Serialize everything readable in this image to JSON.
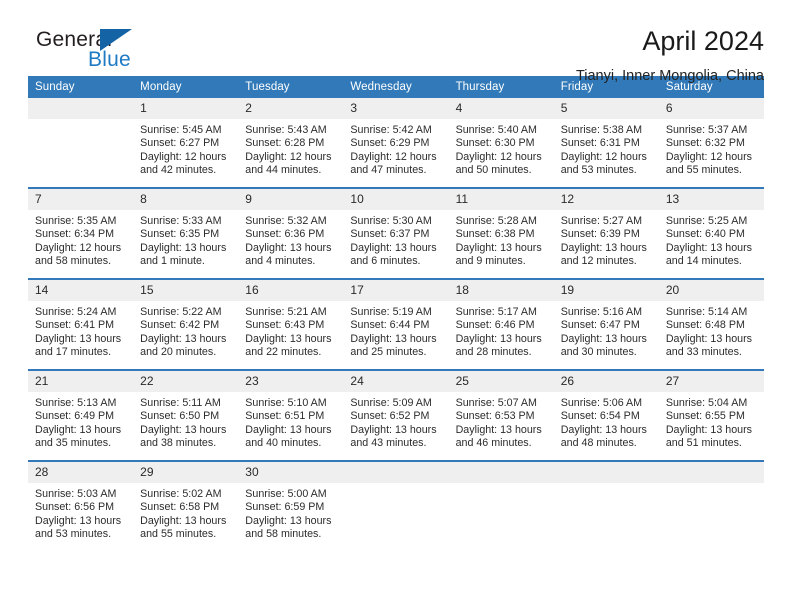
{
  "brand": {
    "name_part1": "General",
    "name_part2": "Blue",
    "logo_icon": "blue-triangle-icon"
  },
  "header": {
    "title": "April 2024",
    "subtitle": "Tianyi, Inner Mongolia, China"
  },
  "colors": {
    "header_blue": "#3179b8",
    "daynum_band": "#efefef",
    "brand_blue": "#1f7ac4",
    "logo_triangle": "#1464a5",
    "text": "#2c2c2c"
  },
  "weekdays": [
    "Sunday",
    "Monday",
    "Tuesday",
    "Wednesday",
    "Thursday",
    "Friday",
    "Saturday"
  ],
  "weeks": [
    [
      {
        "day": "",
        "empty": true,
        "sunrise": "",
        "sunset": "",
        "daylight1": "",
        "daylight2": ""
      },
      {
        "day": "1",
        "sunrise": "Sunrise: 5:45 AM",
        "sunset": "Sunset: 6:27 PM",
        "daylight1": "Daylight: 12 hours",
        "daylight2": "and 42 minutes."
      },
      {
        "day": "2",
        "sunrise": "Sunrise: 5:43 AM",
        "sunset": "Sunset: 6:28 PM",
        "daylight1": "Daylight: 12 hours",
        "daylight2": "and 44 minutes."
      },
      {
        "day": "3",
        "sunrise": "Sunrise: 5:42 AM",
        "sunset": "Sunset: 6:29 PM",
        "daylight1": "Daylight: 12 hours",
        "daylight2": "and 47 minutes."
      },
      {
        "day": "4",
        "sunrise": "Sunrise: 5:40 AM",
        "sunset": "Sunset: 6:30 PM",
        "daylight1": "Daylight: 12 hours",
        "daylight2": "and 50 minutes."
      },
      {
        "day": "5",
        "sunrise": "Sunrise: 5:38 AM",
        "sunset": "Sunset: 6:31 PM",
        "daylight1": "Daylight: 12 hours",
        "daylight2": "and 53 minutes."
      },
      {
        "day": "6",
        "sunrise": "Sunrise: 5:37 AM",
        "sunset": "Sunset: 6:32 PM",
        "daylight1": "Daylight: 12 hours",
        "daylight2": "and 55 minutes."
      }
    ],
    [
      {
        "day": "7",
        "sunrise": "Sunrise: 5:35 AM",
        "sunset": "Sunset: 6:34 PM",
        "daylight1": "Daylight: 12 hours",
        "daylight2": "and 58 minutes."
      },
      {
        "day": "8",
        "sunrise": "Sunrise: 5:33 AM",
        "sunset": "Sunset: 6:35 PM",
        "daylight1": "Daylight: 13 hours",
        "daylight2": "and 1 minute."
      },
      {
        "day": "9",
        "sunrise": "Sunrise: 5:32 AM",
        "sunset": "Sunset: 6:36 PM",
        "daylight1": "Daylight: 13 hours",
        "daylight2": "and 4 minutes."
      },
      {
        "day": "10",
        "sunrise": "Sunrise: 5:30 AM",
        "sunset": "Sunset: 6:37 PM",
        "daylight1": "Daylight: 13 hours",
        "daylight2": "and 6 minutes."
      },
      {
        "day": "11",
        "sunrise": "Sunrise: 5:28 AM",
        "sunset": "Sunset: 6:38 PM",
        "daylight1": "Daylight: 13 hours",
        "daylight2": "and 9 minutes."
      },
      {
        "day": "12",
        "sunrise": "Sunrise: 5:27 AM",
        "sunset": "Sunset: 6:39 PM",
        "daylight1": "Daylight: 13 hours",
        "daylight2": "and 12 minutes."
      },
      {
        "day": "13",
        "sunrise": "Sunrise: 5:25 AM",
        "sunset": "Sunset: 6:40 PM",
        "daylight1": "Daylight: 13 hours",
        "daylight2": "and 14 minutes."
      }
    ],
    [
      {
        "day": "14",
        "sunrise": "Sunrise: 5:24 AM",
        "sunset": "Sunset: 6:41 PM",
        "daylight1": "Daylight: 13 hours",
        "daylight2": "and 17 minutes."
      },
      {
        "day": "15",
        "sunrise": "Sunrise: 5:22 AM",
        "sunset": "Sunset: 6:42 PM",
        "daylight1": "Daylight: 13 hours",
        "daylight2": "and 20 minutes."
      },
      {
        "day": "16",
        "sunrise": "Sunrise: 5:21 AM",
        "sunset": "Sunset: 6:43 PM",
        "daylight1": "Daylight: 13 hours",
        "daylight2": "and 22 minutes."
      },
      {
        "day": "17",
        "sunrise": "Sunrise: 5:19 AM",
        "sunset": "Sunset: 6:44 PM",
        "daylight1": "Daylight: 13 hours",
        "daylight2": "and 25 minutes."
      },
      {
        "day": "18",
        "sunrise": "Sunrise: 5:17 AM",
        "sunset": "Sunset: 6:46 PM",
        "daylight1": "Daylight: 13 hours",
        "daylight2": "and 28 minutes."
      },
      {
        "day": "19",
        "sunrise": "Sunrise: 5:16 AM",
        "sunset": "Sunset: 6:47 PM",
        "daylight1": "Daylight: 13 hours",
        "daylight2": "and 30 minutes."
      },
      {
        "day": "20",
        "sunrise": "Sunrise: 5:14 AM",
        "sunset": "Sunset: 6:48 PM",
        "daylight1": "Daylight: 13 hours",
        "daylight2": "and 33 minutes."
      }
    ],
    [
      {
        "day": "21",
        "sunrise": "Sunrise: 5:13 AM",
        "sunset": "Sunset: 6:49 PM",
        "daylight1": "Daylight: 13 hours",
        "daylight2": "and 35 minutes."
      },
      {
        "day": "22",
        "sunrise": "Sunrise: 5:11 AM",
        "sunset": "Sunset: 6:50 PM",
        "daylight1": "Daylight: 13 hours",
        "daylight2": "and 38 minutes."
      },
      {
        "day": "23",
        "sunrise": "Sunrise: 5:10 AM",
        "sunset": "Sunset: 6:51 PM",
        "daylight1": "Daylight: 13 hours",
        "daylight2": "and 40 minutes."
      },
      {
        "day": "24",
        "sunrise": "Sunrise: 5:09 AM",
        "sunset": "Sunset: 6:52 PM",
        "daylight1": "Daylight: 13 hours",
        "daylight2": "and 43 minutes."
      },
      {
        "day": "25",
        "sunrise": "Sunrise: 5:07 AM",
        "sunset": "Sunset: 6:53 PM",
        "daylight1": "Daylight: 13 hours",
        "daylight2": "and 46 minutes."
      },
      {
        "day": "26",
        "sunrise": "Sunrise: 5:06 AM",
        "sunset": "Sunset: 6:54 PM",
        "daylight1": "Daylight: 13 hours",
        "daylight2": "and 48 minutes."
      },
      {
        "day": "27",
        "sunrise": "Sunrise: 5:04 AM",
        "sunset": "Sunset: 6:55 PM",
        "daylight1": "Daylight: 13 hours",
        "daylight2": "and 51 minutes."
      }
    ],
    [
      {
        "day": "28",
        "sunrise": "Sunrise: 5:03 AM",
        "sunset": "Sunset: 6:56 PM",
        "daylight1": "Daylight: 13 hours",
        "daylight2": "and 53 minutes."
      },
      {
        "day": "29",
        "sunrise": "Sunrise: 5:02 AM",
        "sunset": "Sunset: 6:58 PM",
        "daylight1": "Daylight: 13 hours",
        "daylight2": "and 55 minutes."
      },
      {
        "day": "30",
        "sunrise": "Sunrise: 5:00 AM",
        "sunset": "Sunset: 6:59 PM",
        "daylight1": "Daylight: 13 hours",
        "daylight2": "and 58 minutes."
      },
      {
        "day": "",
        "empty": true,
        "sunrise": "",
        "sunset": "",
        "daylight1": "",
        "daylight2": ""
      },
      {
        "day": "",
        "empty": true,
        "sunrise": "",
        "sunset": "",
        "daylight1": "",
        "daylight2": ""
      },
      {
        "day": "",
        "empty": true,
        "sunrise": "",
        "sunset": "",
        "daylight1": "",
        "daylight2": ""
      },
      {
        "day": "",
        "empty": true,
        "sunrise": "",
        "sunset": "",
        "daylight1": "",
        "daylight2": ""
      }
    ]
  ]
}
